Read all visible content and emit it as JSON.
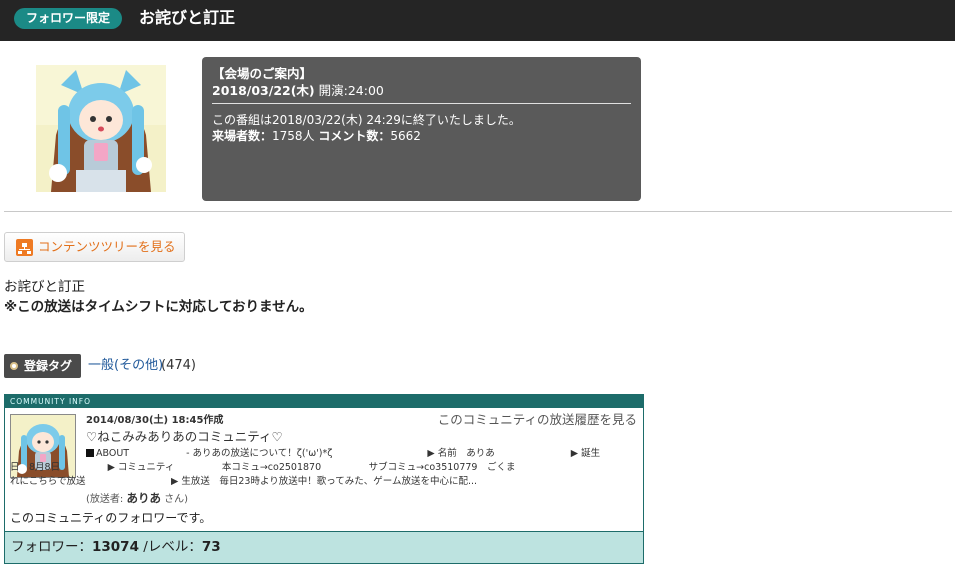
{
  "header": {
    "badge": "フォロワー限定",
    "title": "お詫びと訂正"
  },
  "program": {
    "venue_title": "【会場のご案内】",
    "date": "2018/03/22(木)",
    "open_label": "開演:24:00",
    "ended_text": "この番組は2018/03/22(木) 24:29に終了いたしました。",
    "visitors_label": "来場者数：",
    "visitors": "1758人",
    "comments_label": "コメント数：",
    "comments": "5662"
  },
  "tree_button": {
    "label": "コンテンツツリーを見る"
  },
  "description": {
    "line1": "お詫びと訂正",
    "line2": "※この放送はタイムシフトに対応しておりません。"
  },
  "tags": {
    "label": "登録タグ",
    "link": "一般(その他)",
    "count": "(474)"
  },
  "community": {
    "header": "COMMUNITY INFO",
    "created": "2014/08/30(土) 18:45作成",
    "history_link": "このコミュニティの放送履歴を見る",
    "name": "♡ねこみみありあのコミュニティ♡",
    "about_line": "ABOUT　　　　　　- ありあの放送について！ζ('ω')*ζ　　　　　　　　　　▶ 名前　ありあ　　　　　　　　▶ 誕生",
    "body_line2": "日　8月8日　　　　　▶ コミュニティ　　　　　本コミュ→co2501870　　　　　サブコミュ→co3510779　ごくま",
    "body_line3": "れにこちらで放送　　　　　　　　　▶ 生放送　毎日23時より放送中！歌ってみた、ゲーム放送を中心に配...",
    "owner_prefix": "(放送者:",
    "owner_name": "ありあ",
    "owner_suffix": "さん)",
    "follow_text": "このコミュニティのフォロワーです。",
    "followers_label": "フォロワー：",
    "followers": "13074",
    "level_label": "/レベル：",
    "level": "73"
  }
}
